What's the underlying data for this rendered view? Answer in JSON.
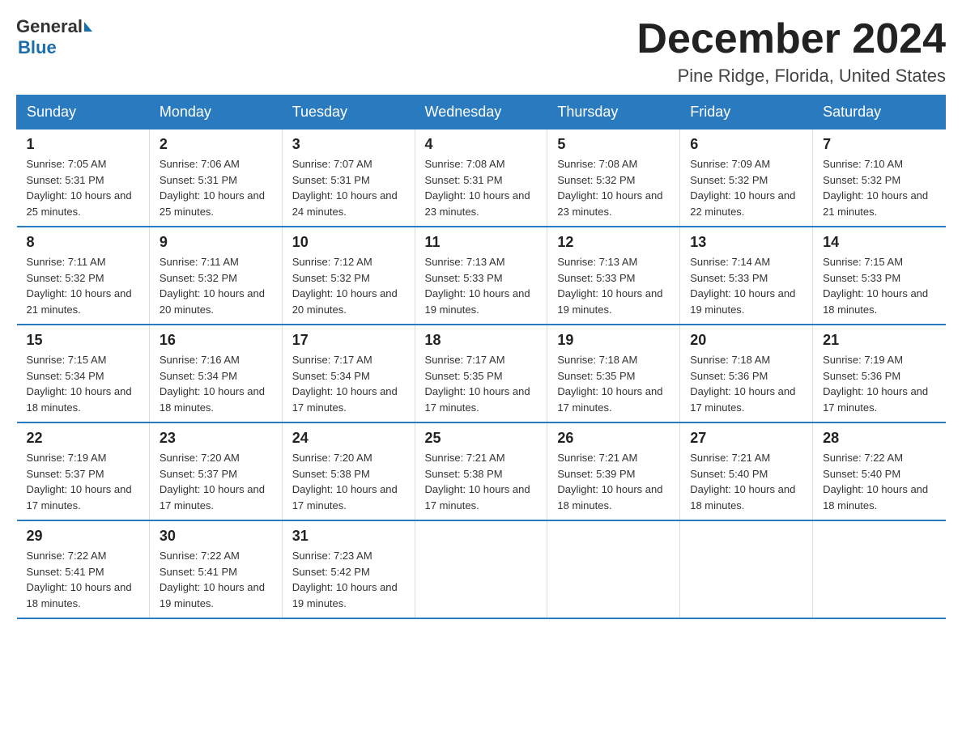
{
  "header": {
    "logo_general": "General",
    "logo_blue": "Blue",
    "title": "December 2024",
    "subtitle": "Pine Ridge, Florida, United States"
  },
  "days_of_week": [
    "Sunday",
    "Monday",
    "Tuesday",
    "Wednesday",
    "Thursday",
    "Friday",
    "Saturday"
  ],
  "weeks": [
    [
      {
        "day": "1",
        "sunrise": "Sunrise: 7:05 AM",
        "sunset": "Sunset: 5:31 PM",
        "daylight": "Daylight: 10 hours and 25 minutes."
      },
      {
        "day": "2",
        "sunrise": "Sunrise: 7:06 AM",
        "sunset": "Sunset: 5:31 PM",
        "daylight": "Daylight: 10 hours and 25 minutes."
      },
      {
        "day": "3",
        "sunrise": "Sunrise: 7:07 AM",
        "sunset": "Sunset: 5:31 PM",
        "daylight": "Daylight: 10 hours and 24 minutes."
      },
      {
        "day": "4",
        "sunrise": "Sunrise: 7:08 AM",
        "sunset": "Sunset: 5:31 PM",
        "daylight": "Daylight: 10 hours and 23 minutes."
      },
      {
        "day": "5",
        "sunrise": "Sunrise: 7:08 AM",
        "sunset": "Sunset: 5:32 PM",
        "daylight": "Daylight: 10 hours and 23 minutes."
      },
      {
        "day": "6",
        "sunrise": "Sunrise: 7:09 AM",
        "sunset": "Sunset: 5:32 PM",
        "daylight": "Daylight: 10 hours and 22 minutes."
      },
      {
        "day": "7",
        "sunrise": "Sunrise: 7:10 AM",
        "sunset": "Sunset: 5:32 PM",
        "daylight": "Daylight: 10 hours and 21 minutes."
      }
    ],
    [
      {
        "day": "8",
        "sunrise": "Sunrise: 7:11 AM",
        "sunset": "Sunset: 5:32 PM",
        "daylight": "Daylight: 10 hours and 21 minutes."
      },
      {
        "day": "9",
        "sunrise": "Sunrise: 7:11 AM",
        "sunset": "Sunset: 5:32 PM",
        "daylight": "Daylight: 10 hours and 20 minutes."
      },
      {
        "day": "10",
        "sunrise": "Sunrise: 7:12 AM",
        "sunset": "Sunset: 5:32 PM",
        "daylight": "Daylight: 10 hours and 20 minutes."
      },
      {
        "day": "11",
        "sunrise": "Sunrise: 7:13 AM",
        "sunset": "Sunset: 5:33 PM",
        "daylight": "Daylight: 10 hours and 19 minutes."
      },
      {
        "day": "12",
        "sunrise": "Sunrise: 7:13 AM",
        "sunset": "Sunset: 5:33 PM",
        "daylight": "Daylight: 10 hours and 19 minutes."
      },
      {
        "day": "13",
        "sunrise": "Sunrise: 7:14 AM",
        "sunset": "Sunset: 5:33 PM",
        "daylight": "Daylight: 10 hours and 19 minutes."
      },
      {
        "day": "14",
        "sunrise": "Sunrise: 7:15 AM",
        "sunset": "Sunset: 5:33 PM",
        "daylight": "Daylight: 10 hours and 18 minutes."
      }
    ],
    [
      {
        "day": "15",
        "sunrise": "Sunrise: 7:15 AM",
        "sunset": "Sunset: 5:34 PM",
        "daylight": "Daylight: 10 hours and 18 minutes."
      },
      {
        "day": "16",
        "sunrise": "Sunrise: 7:16 AM",
        "sunset": "Sunset: 5:34 PM",
        "daylight": "Daylight: 10 hours and 18 minutes."
      },
      {
        "day": "17",
        "sunrise": "Sunrise: 7:17 AM",
        "sunset": "Sunset: 5:34 PM",
        "daylight": "Daylight: 10 hours and 17 minutes."
      },
      {
        "day": "18",
        "sunrise": "Sunrise: 7:17 AM",
        "sunset": "Sunset: 5:35 PM",
        "daylight": "Daylight: 10 hours and 17 minutes."
      },
      {
        "day": "19",
        "sunrise": "Sunrise: 7:18 AM",
        "sunset": "Sunset: 5:35 PM",
        "daylight": "Daylight: 10 hours and 17 minutes."
      },
      {
        "day": "20",
        "sunrise": "Sunrise: 7:18 AM",
        "sunset": "Sunset: 5:36 PM",
        "daylight": "Daylight: 10 hours and 17 minutes."
      },
      {
        "day": "21",
        "sunrise": "Sunrise: 7:19 AM",
        "sunset": "Sunset: 5:36 PM",
        "daylight": "Daylight: 10 hours and 17 minutes."
      }
    ],
    [
      {
        "day": "22",
        "sunrise": "Sunrise: 7:19 AM",
        "sunset": "Sunset: 5:37 PM",
        "daylight": "Daylight: 10 hours and 17 minutes."
      },
      {
        "day": "23",
        "sunrise": "Sunrise: 7:20 AM",
        "sunset": "Sunset: 5:37 PM",
        "daylight": "Daylight: 10 hours and 17 minutes."
      },
      {
        "day": "24",
        "sunrise": "Sunrise: 7:20 AM",
        "sunset": "Sunset: 5:38 PM",
        "daylight": "Daylight: 10 hours and 17 minutes."
      },
      {
        "day": "25",
        "sunrise": "Sunrise: 7:21 AM",
        "sunset": "Sunset: 5:38 PM",
        "daylight": "Daylight: 10 hours and 17 minutes."
      },
      {
        "day": "26",
        "sunrise": "Sunrise: 7:21 AM",
        "sunset": "Sunset: 5:39 PM",
        "daylight": "Daylight: 10 hours and 18 minutes."
      },
      {
        "day": "27",
        "sunrise": "Sunrise: 7:21 AM",
        "sunset": "Sunset: 5:40 PM",
        "daylight": "Daylight: 10 hours and 18 minutes."
      },
      {
        "day": "28",
        "sunrise": "Sunrise: 7:22 AM",
        "sunset": "Sunset: 5:40 PM",
        "daylight": "Daylight: 10 hours and 18 minutes."
      }
    ],
    [
      {
        "day": "29",
        "sunrise": "Sunrise: 7:22 AM",
        "sunset": "Sunset: 5:41 PM",
        "daylight": "Daylight: 10 hours and 18 minutes."
      },
      {
        "day": "30",
        "sunrise": "Sunrise: 7:22 AM",
        "sunset": "Sunset: 5:41 PM",
        "daylight": "Daylight: 10 hours and 19 minutes."
      },
      {
        "day": "31",
        "sunrise": "Sunrise: 7:23 AM",
        "sunset": "Sunset: 5:42 PM",
        "daylight": "Daylight: 10 hours and 19 minutes."
      },
      {
        "day": "",
        "sunrise": "",
        "sunset": "",
        "daylight": ""
      },
      {
        "day": "",
        "sunrise": "",
        "sunset": "",
        "daylight": ""
      },
      {
        "day": "",
        "sunrise": "",
        "sunset": "",
        "daylight": ""
      },
      {
        "day": "",
        "sunrise": "",
        "sunset": "",
        "daylight": ""
      }
    ]
  ]
}
